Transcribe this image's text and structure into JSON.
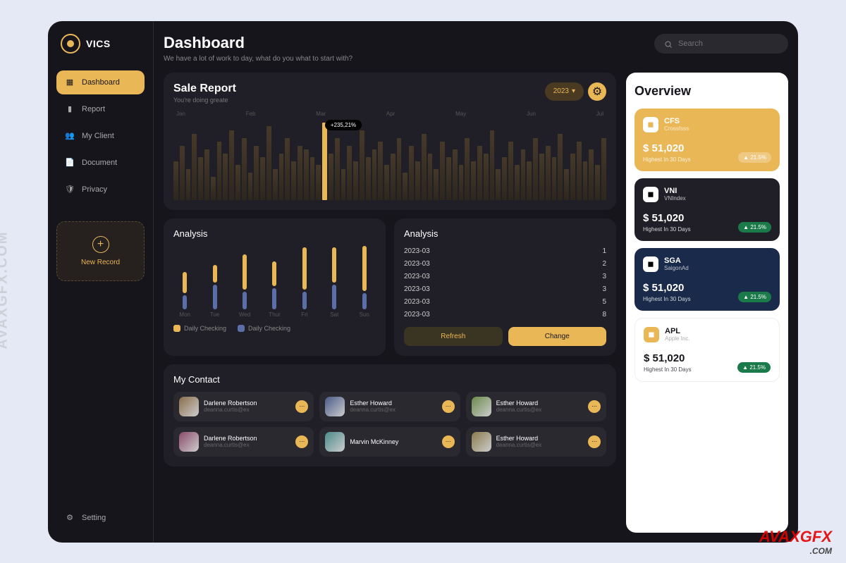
{
  "brand": "VICS",
  "sidebar": {
    "items": [
      {
        "label": "Dashboard",
        "icon": "grid"
      },
      {
        "label": "Report",
        "icon": "chart"
      },
      {
        "label": "My Client",
        "icon": "users"
      },
      {
        "label": "Document",
        "icon": "doc"
      },
      {
        "label": "Privacy",
        "icon": "shield"
      }
    ],
    "new_record": "New Record",
    "setting": "Setting"
  },
  "header": {
    "title": "Dashboard",
    "subtitle": "We have a lot of work to day, what do you what to start with?",
    "search_placeholder": "Search"
  },
  "sale_report": {
    "title": "Sale Report",
    "subtitle": "You're doing greate",
    "year": "2023",
    "tooltip": "+235,21%",
    "months": [
      "Jan",
      "Feb",
      "Mar",
      "Apr",
      "May",
      "Jun",
      "Jul"
    ]
  },
  "chart_data": {
    "type": "bar",
    "title": "Sale Report",
    "categories": [
      "Jan",
      "Feb",
      "Mar",
      "Apr",
      "May",
      "Jun",
      "Jul"
    ],
    "highlight_index": 24,
    "tooltip_value": "+235,21%",
    "bar_heights_pct": [
      50,
      70,
      40,
      85,
      55,
      65,
      30,
      75,
      60,
      90,
      45,
      80,
      35,
      70,
      55,
      95,
      40,
      60,
      80,
      50,
      70,
      65,
      55,
      45,
      100,
      60,
      80,
      40,
      70,
      50,
      90,
      55,
      65,
      75,
      45,
      60,
      80,
      35,
      70,
      50,
      85,
      60,
      40,
      75,
      55,
      65,
      45,
      80,
      50,
      70,
      60,
      90,
      40,
      55,
      75,
      45,
      65,
      50,
      80,
      60,
      70,
      55,
      85,
      40,
      60,
      75,
      50,
      65,
      45,
      80
    ]
  },
  "analysis_chart": {
    "title": "Analysis",
    "days": [
      "Mon",
      "Tue",
      "Wed",
      "Thur",
      "Fri",
      "Sat",
      "Sun"
    ],
    "series": [
      {
        "name": "Daily Checking",
        "color": "#eab757",
        "values": [
          30,
          25,
          50,
          35,
          60,
          50,
          70
        ]
      },
      {
        "name": "Daily Checking",
        "color": "#5a6fa8",
        "values": [
          20,
          35,
          25,
          30,
          25,
          35,
          25
        ]
      }
    ]
  },
  "analysis_list": {
    "title": "Analysis",
    "rows": [
      {
        "date": "2023-03",
        "val": "1"
      },
      {
        "date": "2023-03",
        "val": "2"
      },
      {
        "date": "2023-03",
        "val": "3"
      },
      {
        "date": "2023-03",
        "val": "3"
      },
      {
        "date": "2023-03",
        "val": "5"
      },
      {
        "date": "2023-03",
        "val": "8"
      }
    ],
    "refresh": "Refresh",
    "change": "Change"
  },
  "contacts": {
    "title": "My Contact",
    "items": [
      {
        "name": "Darlene Robertson",
        "email": "deanna.curtis@ex"
      },
      {
        "name": "Esther Howard",
        "email": "deanna.curtis@ex"
      },
      {
        "name": "Esther Howard",
        "email": "deanna.curtis@ex"
      },
      {
        "name": "Darlene Robertson",
        "email": "deanna.curtis@ex"
      },
      {
        "name": "Marvin McKinney",
        "email": ""
      },
      {
        "name": "Esther Howard",
        "email": "deanna.curtis@ex"
      }
    ]
  },
  "overview": {
    "title": "Overview",
    "cards": [
      {
        "code": "CFS",
        "name": "Crossfsss",
        "value": "$ 51,020",
        "high": "Highest In 30 Days",
        "badge": "▲ 21.5%",
        "theme": "yellow"
      },
      {
        "code": "VNI",
        "name": "VNIndex",
        "value": "$ 51,020",
        "high": "Highest In 30 Days",
        "badge": "▲ 21.5%",
        "theme": "dark"
      },
      {
        "code": "SGA",
        "name": "SaigonAd",
        "value": "$ 51,020",
        "high": "Highest In 30 Days",
        "badge": "▲ 21.5%",
        "theme": "navy"
      },
      {
        "code": "APL",
        "name": "Apple Inc.",
        "value": "$ 51,020",
        "high": "Highest In 30 Days",
        "badge": "▲ 21.5%",
        "theme": "white"
      }
    ]
  },
  "watermarks": {
    "side": "AVAXGFX.COM",
    "corner": "AVAXGFX",
    "corner_sub": ".COM"
  }
}
